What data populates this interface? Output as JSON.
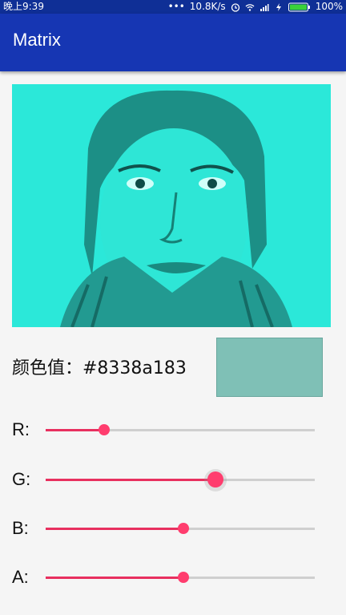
{
  "status": {
    "time": "晚上9:39",
    "dots": "•••",
    "speed": "10.8K/s",
    "battery": "100%"
  },
  "app": {
    "title": "Matrix"
  },
  "color": {
    "label": "颜色值：#8338a183",
    "swatch_color": "#7fc0b6"
  },
  "sliders": [
    {
      "label": "R:",
      "value_fraction": 0.22
    },
    {
      "label": "G:",
      "value_fraction": 0.63,
      "focused": true
    },
    {
      "label": "B:",
      "value_fraction": 0.51
    },
    {
      "label": "A:",
      "value_fraction": 0.51
    }
  ],
  "accent": "#ff3d6e"
}
